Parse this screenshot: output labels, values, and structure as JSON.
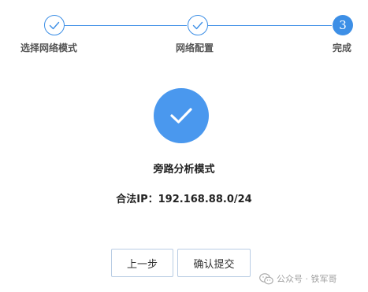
{
  "stepper": {
    "steps": [
      {
        "label": "选择网络模式",
        "state": "done",
        "icon": "check-icon"
      },
      {
        "label": "网络配置",
        "state": "done",
        "icon": "check-icon"
      },
      {
        "label": "完成",
        "state": "current",
        "number": "3"
      }
    ],
    "accent_color": "#3d8fe6"
  },
  "result": {
    "icon": "check-icon",
    "icon_color": "#4a98ee",
    "mode_title": "旁路分析模式",
    "ip_label": "合法IP：",
    "ip_value": "192.168.88.0/24"
  },
  "buttons": {
    "prev_label": "上一步",
    "confirm_label": "确认提交"
  },
  "watermark": {
    "icon": "wechat-icon",
    "text": "公众号 · 铁军哥"
  }
}
